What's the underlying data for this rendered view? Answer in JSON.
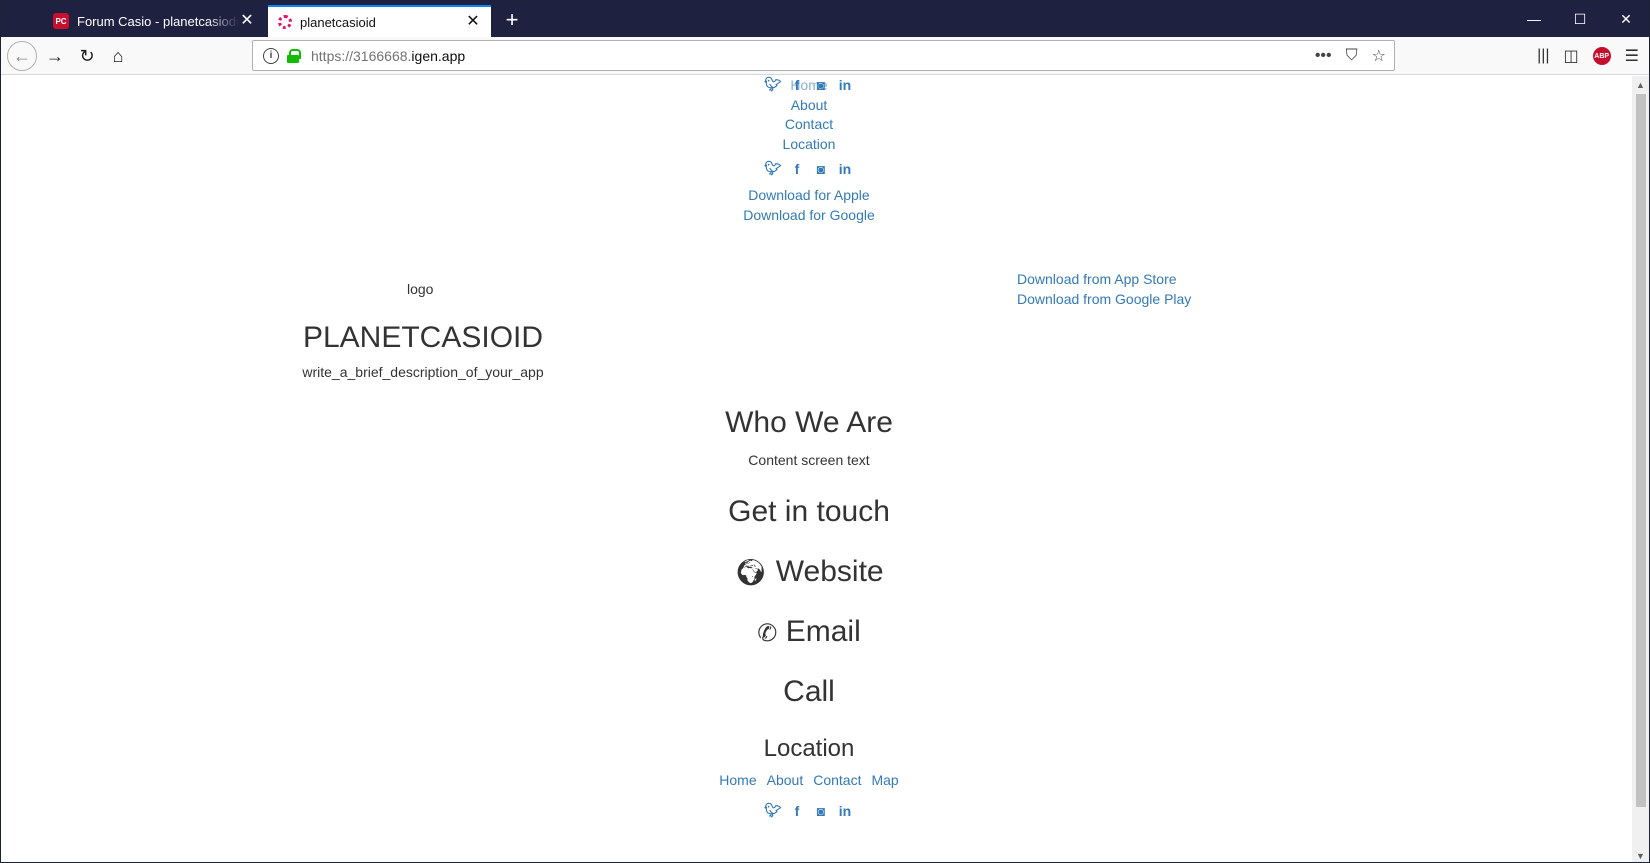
{
  "browser": {
    "tabs": [
      {
        "title": "Forum Casio - planetcasiodroid",
        "favicon_text": "PC"
      },
      {
        "title": "planetcasioid"
      }
    ],
    "url": {
      "prefix": "https://3166668.",
      "domain": "igen.app"
    },
    "abp_label": "ABP"
  },
  "page": {
    "top_nav": [
      "Home",
      "About",
      "Contact",
      "Location"
    ],
    "downloads": [
      "Download for Apple",
      "Download for Google"
    ],
    "logo_text": "logo",
    "app_title": "PLANETCASIOID",
    "app_description": "write_a_brief_description_of_your_app",
    "store_links": [
      "Download from App Store",
      "Download from Google Play"
    ],
    "who_we_are_heading": "Who We Are",
    "content_text": "Content screen text",
    "get_in_touch_heading": "Get in touch",
    "website_label": "Website",
    "email_label": "Email",
    "call_label": "Call",
    "location_heading": "Location",
    "footer_nav": [
      "Home",
      "About",
      "Contact",
      "Map"
    ]
  },
  "colors": {
    "link": "#337ab7",
    "text": "#333333",
    "tabbar": "#1f2140"
  }
}
